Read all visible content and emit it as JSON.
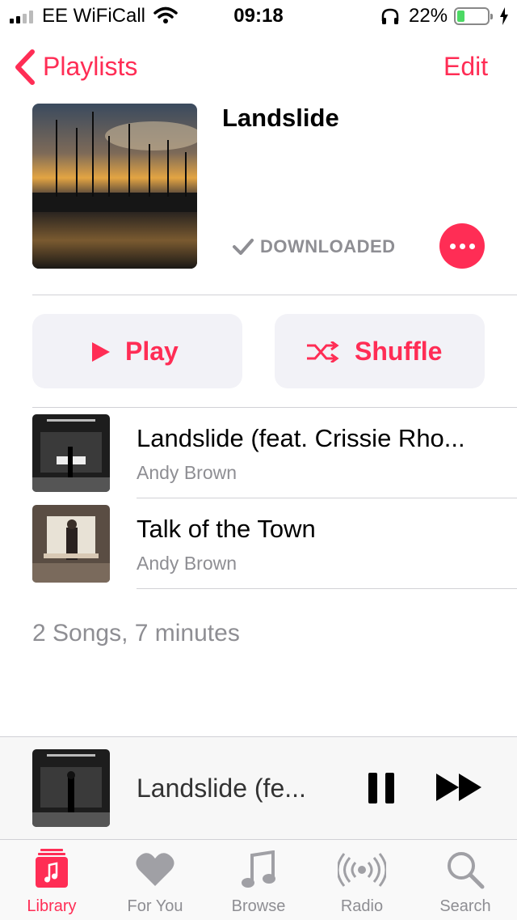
{
  "status_bar": {
    "carrier": "EE WiFiCall",
    "time": "09:18",
    "battery_percent": "22%"
  },
  "nav": {
    "back_label": "Playlists",
    "edit_label": "Edit"
  },
  "playlist": {
    "title": "Landslide",
    "status": "DOWNLOADED"
  },
  "actions": {
    "play_label": "Play",
    "shuffle_label": "Shuffle"
  },
  "songs": [
    {
      "title": "Landslide (feat. Crissie Rho...",
      "artist": "Andy Brown"
    },
    {
      "title": "Talk of the Town",
      "artist": "Andy Brown"
    }
  ],
  "summary": "2 Songs, 7 minutes",
  "now_playing": {
    "title": "Landslide (fe..."
  },
  "tabs": [
    {
      "label": "Library",
      "icon": "library-icon",
      "active": true
    },
    {
      "label": "For You",
      "icon": "heart-icon",
      "active": false
    },
    {
      "label": "Browse",
      "icon": "music-note-icon",
      "active": false
    },
    {
      "label": "Radio",
      "icon": "radio-icon",
      "active": false
    },
    {
      "label": "Search",
      "icon": "search-icon",
      "active": false
    }
  ],
  "colors": {
    "accent": "#ff2d55",
    "secondary_text": "#8e8e93",
    "battery": "#4cd964"
  }
}
